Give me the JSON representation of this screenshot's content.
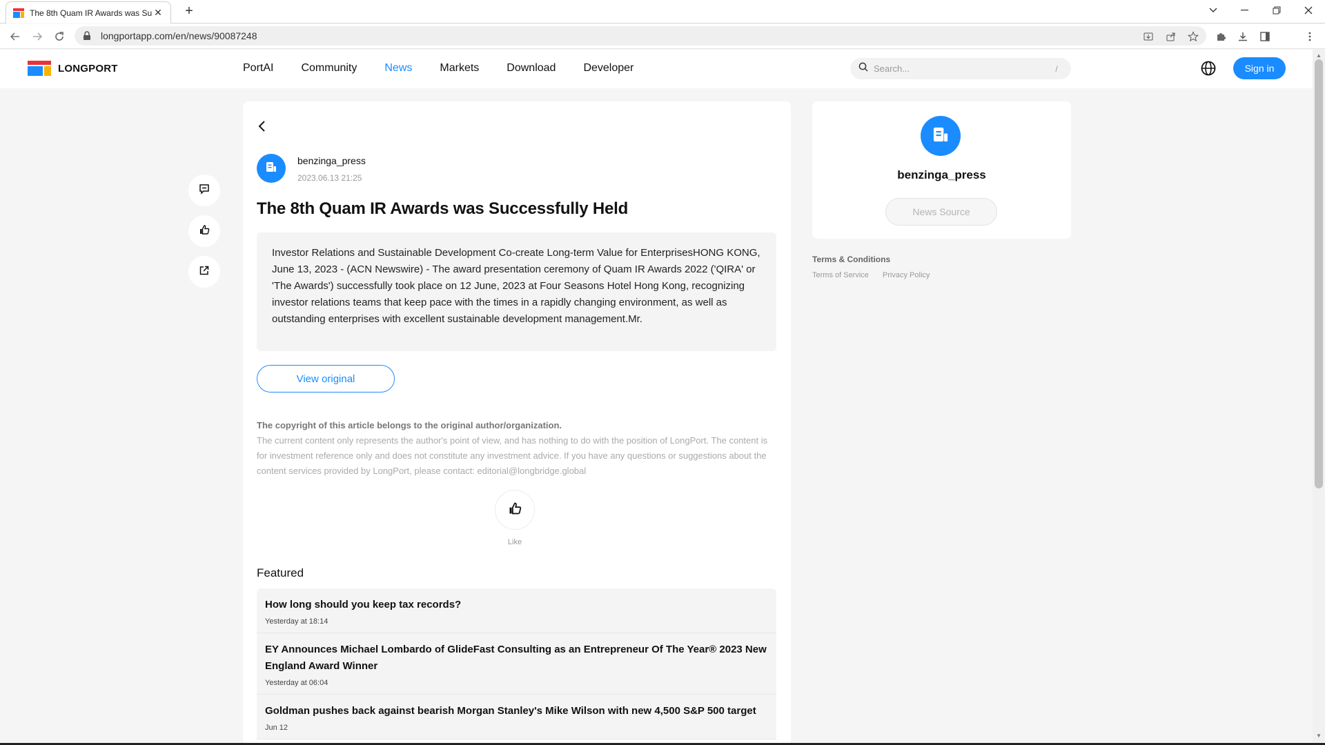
{
  "browser": {
    "tab_title": "The 8th Quam IR Awards was Su",
    "url": "longportapp.com/en/news/90087248"
  },
  "header": {
    "logo_text": "LONGPORT",
    "nav": [
      "PortAI",
      "Community",
      "News",
      "Markets",
      "Download",
      "Developer"
    ],
    "active_nav": "News",
    "search_placeholder": "Search...",
    "search_shortcut": "/",
    "signin_label": "Sign in"
  },
  "article": {
    "author": "benzinga_press",
    "timestamp": "2023.06.13 21:25",
    "title": "The 8th Quam IR Awards was Successfully Held",
    "summary": "Investor Relations and Sustainable Development Co-create Long-term Value for EnterprisesHONG KONG, June 13, 2023 - (ACN Newswire) - The award presentation ceremony of Quam IR Awards 2022 ('QIRA' or 'The Awards') successfully took place on 12 June, 2023 at Four Seasons Hotel Hong Kong, recognizing investor relations teams that keep pace with the times in a rapidly changing environment, as well as outstanding enterprises with excellent sustainable development management.Mr.",
    "view_original_label": "View original",
    "copyright_title": "The copyright of this article belongs to the original author/organization.",
    "copyright_body": "The current content only represents the author's point of view, and has nothing to do with the position of LongPort. The content is for investment reference only and does not constitute any investment advice. If you have any questions or suggestions about the content services provided by LongPort, please contact: editorial@longbridge.global",
    "like_label": "Like"
  },
  "featured": {
    "title": "Featured",
    "items": [
      {
        "title": "How long should you keep tax records?",
        "time": "Yesterday at 18:14"
      },
      {
        "title": "EY Announces Michael Lombardo of GlideFast Consulting as an Entrepreneur Of The Year® 2023 New England Award Winner",
        "time": "Yesterday at 06:04"
      },
      {
        "title": "Goldman pushes back against bearish Morgan Stanley's Mike Wilson with new 4,500 S&P 500 target",
        "time": "Jun 12"
      }
    ]
  },
  "sidebar": {
    "source_name": "benzinga_press",
    "source_button": "News Source",
    "terms_title": "Terms & Conditions",
    "terms_links": [
      "Terms of Service",
      "Privacy Policy"
    ]
  },
  "colors": {
    "accent": "#1a8cff",
    "page_bg": "#f5f5f6"
  }
}
